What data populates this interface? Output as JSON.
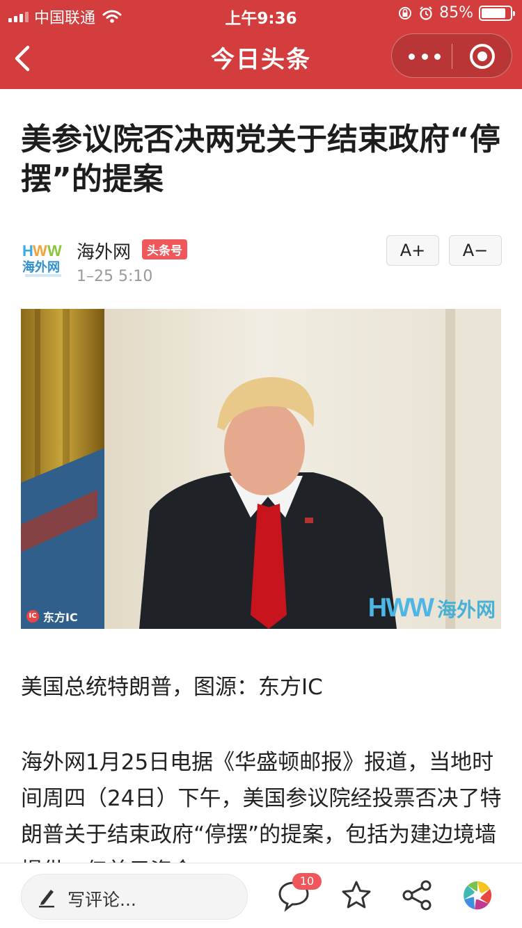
{
  "status_bar": {
    "carrier": "中国联通",
    "time": "上午9:36",
    "battery": "85%",
    "battery_level": 0.85
  },
  "nav": {
    "title": "今日头条"
  },
  "article": {
    "headline": "美参议院否决两党关于结束政府“停摆”的提案",
    "source_name": "海外网",
    "source_badge": "头条号",
    "publish_time": "1–25 5:10",
    "font_increase": "A+",
    "font_decrease": "A−",
    "photo_credit": "东方IC",
    "photo_credit_mark": "IC",
    "watermark_letters": "HWW",
    "watermark_cn": "海外网",
    "caption": "美国总统特朗普，图源：东方IC",
    "body": "海外网1月25日电据《华盛顿邮报》报道，当地时间周四（24日）下午，美国参议院经投票否决了特朗普关于结束政府“停摆”的提案，包括为建边境墙提供…亿美元资金"
  },
  "bottom_bar": {
    "comment_placeholder": "写评论...",
    "comment_count": "10"
  },
  "colors": {
    "brand_red": "#d43d3d",
    "badge_red": "#f0575a"
  },
  "icons": [
    "back-arrow-icon",
    "more-dots-icon",
    "close-target-icon",
    "pen-icon",
    "comment-icon",
    "star-icon",
    "share-icon",
    "moments-icon"
  ]
}
